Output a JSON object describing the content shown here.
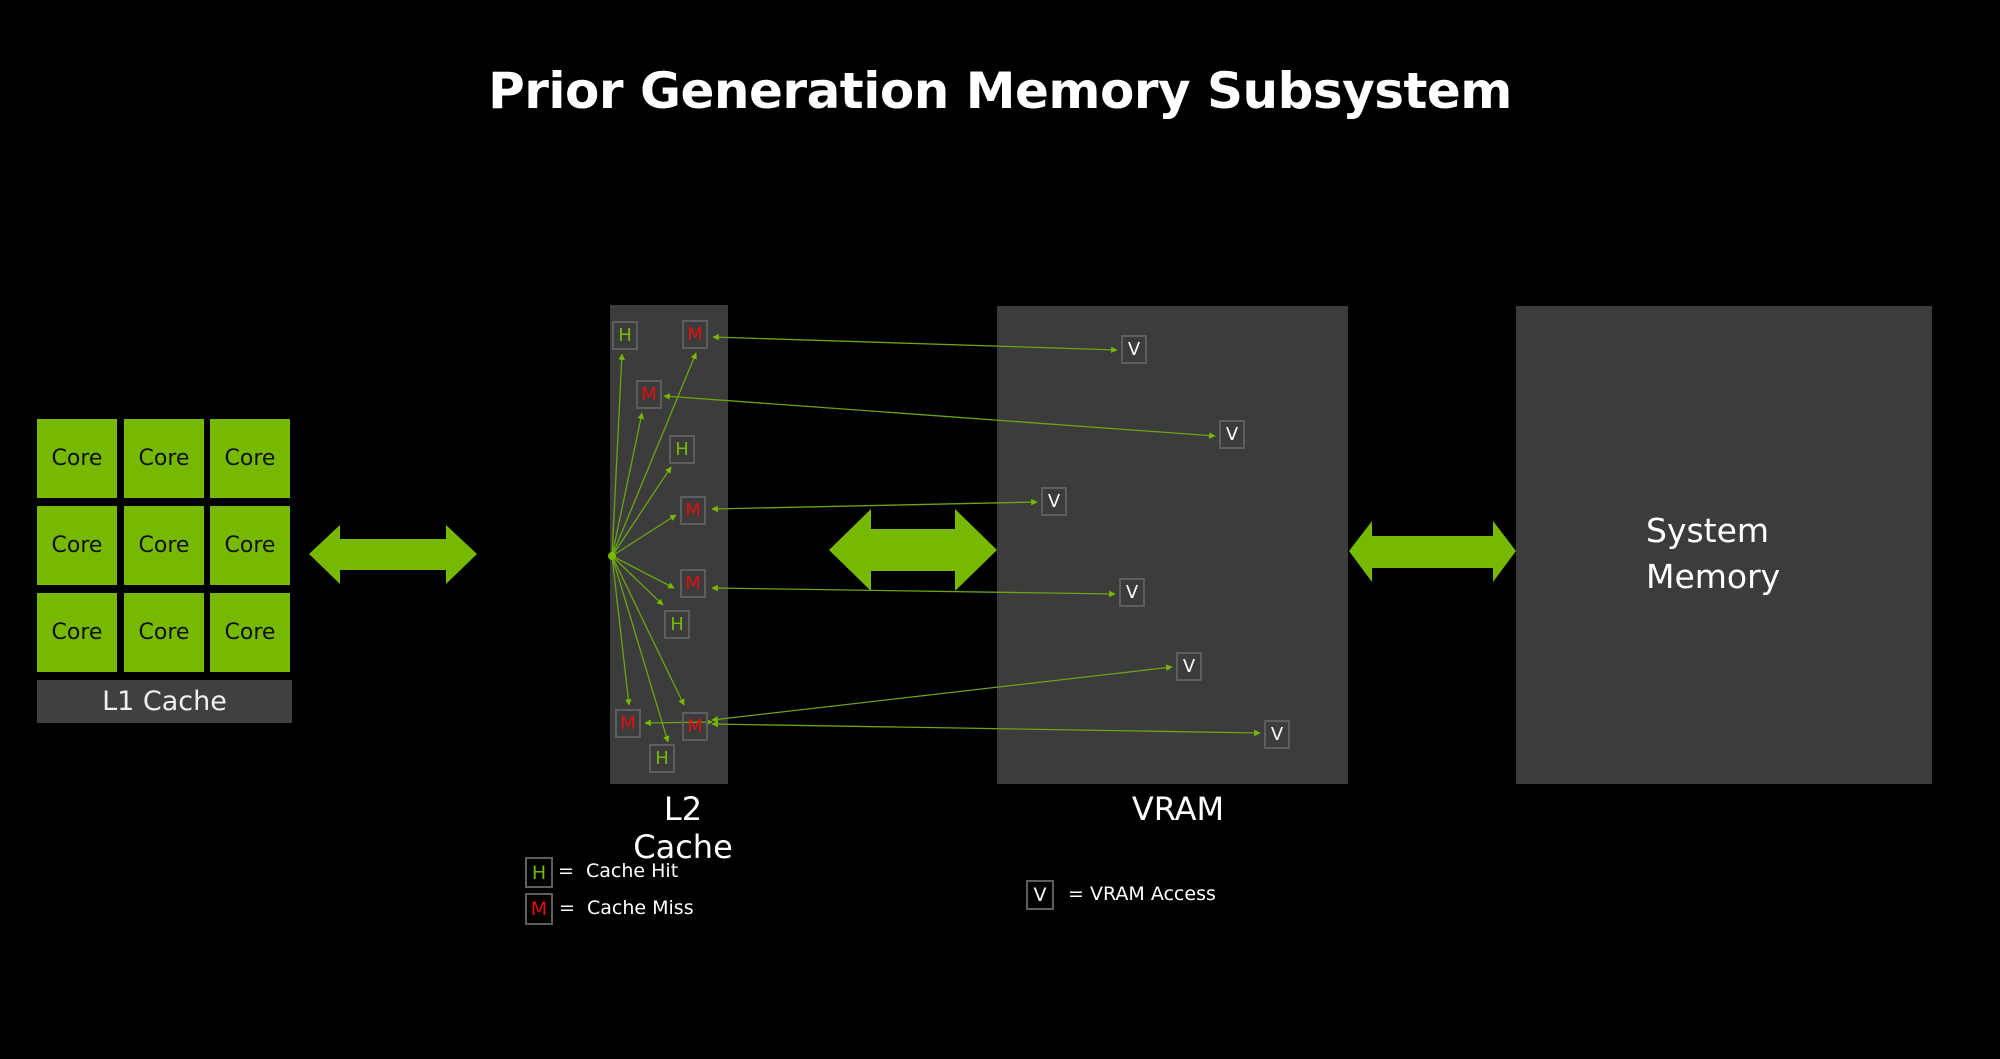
{
  "title": "Prior Generation Memory Subsystem",
  "colors": {
    "accent_green": "#76b900",
    "miss_red": "#e01010",
    "panel_gray": "#3c3c3c",
    "background": "#000000"
  },
  "cores": {
    "label": "Core",
    "count": 9,
    "items": [
      "Core",
      "Core",
      "Core",
      "Core",
      "Core",
      "Core",
      "Core",
      "Core",
      "Core"
    ]
  },
  "l1_cache": {
    "label": "L1 Cache"
  },
  "l2_cache": {
    "label": "L2 Cache",
    "entries": [
      {
        "type": "H",
        "label": "H"
      },
      {
        "type": "M",
        "label": "M"
      },
      {
        "type": "M",
        "label": "M"
      },
      {
        "type": "H",
        "label": "H"
      },
      {
        "type": "M",
        "label": "M"
      },
      {
        "type": "M",
        "label": "M"
      },
      {
        "type": "H",
        "label": "H"
      },
      {
        "type": "M",
        "label": "M"
      },
      {
        "type": "M",
        "label": "M"
      },
      {
        "type": "H",
        "label": "H"
      }
    ]
  },
  "vram": {
    "label": "VRAM",
    "entries": [
      {
        "label": "V"
      },
      {
        "label": "V"
      },
      {
        "label": "V"
      },
      {
        "label": "V"
      },
      {
        "label": "V"
      },
      {
        "label": "V"
      }
    ]
  },
  "system_memory": {
    "label": "System\nMemory"
  },
  "legend": {
    "hit": {
      "symbol": "H",
      "text": "=  Cache Hit"
    },
    "miss": {
      "symbol": "M",
      "text": "=  Cache Miss"
    },
    "vram": {
      "symbol": "V",
      "text": "= VRAM Access"
    }
  },
  "connections": {
    "l2_internal": [
      "H0",
      "M1",
      "M2",
      "H3",
      "M4",
      "M5",
      "H6",
      "M7",
      "M8",
      "H9"
    ],
    "miss_to_vram": [
      {
        "from": "M1",
        "to": "V0"
      },
      {
        "from": "M2",
        "to": "V1"
      },
      {
        "from": "M4",
        "to": "V2"
      },
      {
        "from": "M5",
        "to": "V3"
      },
      {
        "from": "M8",
        "to": "V4"
      },
      {
        "from": "M8",
        "to": "V5"
      },
      {
        "from": "M8",
        "to": "M7"
      }
    ]
  }
}
